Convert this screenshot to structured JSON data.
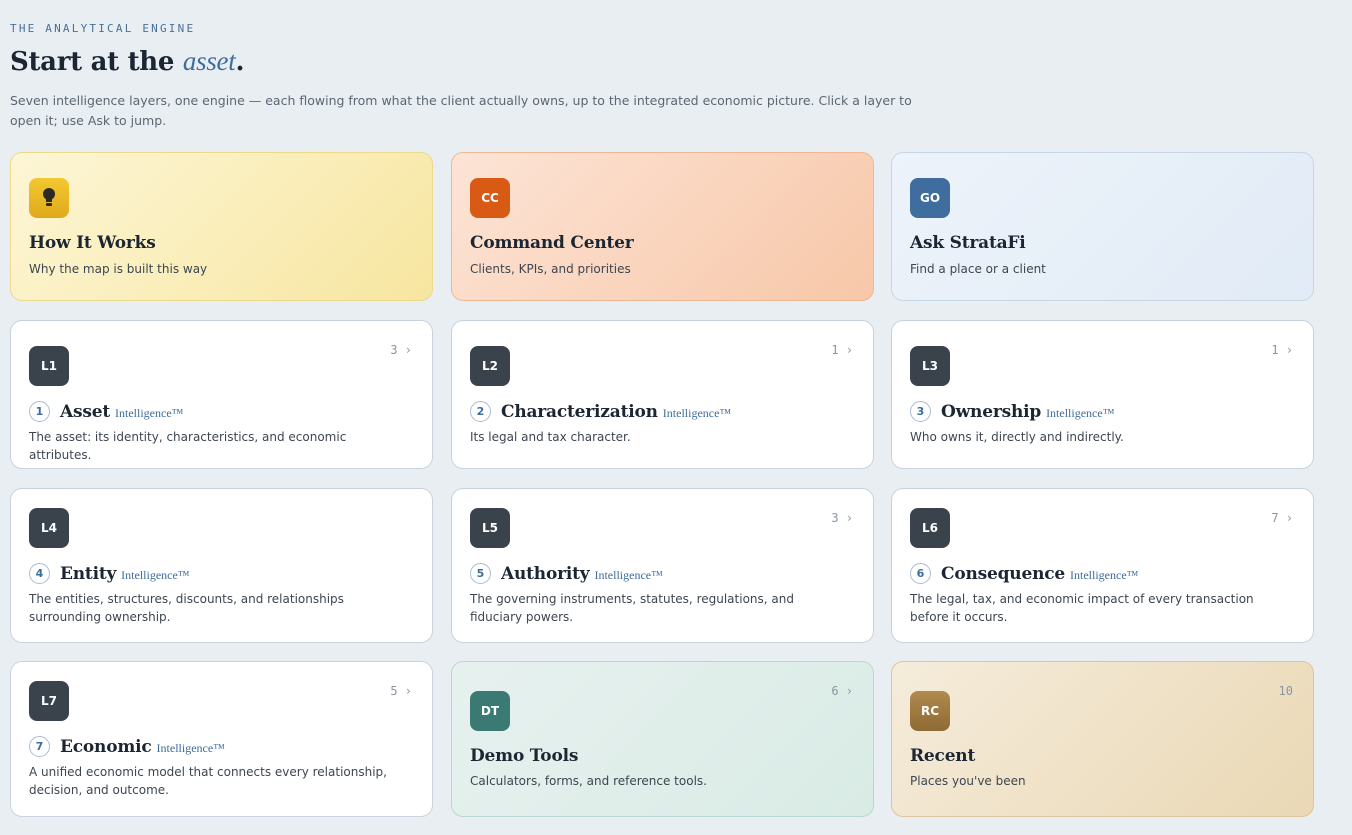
{
  "header": {
    "eyebrow": "THE ANALYTICAL ENGINE",
    "title_prefix": "Start at the ",
    "title_emphasis": "asset",
    "title_suffix": ".",
    "subtitle": "Seven intelligence layers, one engine — each flowing from what the client actually owns, up to the integrated economic picture. Click a layer to open it; use Ask to jump."
  },
  "top_cards": [
    {
      "badge": "",
      "icon": "lightbulb-icon",
      "title": "How It Works",
      "desc": "Why the map is built this way"
    },
    {
      "badge": "CC",
      "title": "Command Center",
      "desc": "Clients, KPIs, and priorities"
    },
    {
      "badge": "GO",
      "title": "Ask StrataFi",
      "desc": "Find a place or a client"
    }
  ],
  "layer_suffix": "Intelligence™",
  "layers": [
    {
      "badge": "L1",
      "num": "1",
      "name": "Asset",
      "desc": "The asset: its identity, characteristics, and economic attributes.",
      "count": "3 ›"
    },
    {
      "badge": "L2",
      "num": "2",
      "name": "Characterization",
      "desc": "Its legal and tax character.",
      "count": "1 ›"
    },
    {
      "badge": "L3",
      "num": "3",
      "name": "Ownership",
      "desc": "Who owns it, directly and indirectly.",
      "count": "1 ›"
    },
    {
      "badge": "L4",
      "num": "4",
      "name": "Entity",
      "desc": "The entities, structures, discounts, and relationships surrounding ownership.",
      "count": ""
    },
    {
      "badge": "L5",
      "num": "5",
      "name": "Authority",
      "desc": "The governing instruments, statutes, regulations, and fiduciary powers.",
      "count": "3 ›"
    },
    {
      "badge": "L6",
      "num": "6",
      "name": "Consequence",
      "desc": "The legal, tax, and economic impact of every transaction before it occurs.",
      "count": "7 ›"
    },
    {
      "badge": "L7",
      "num": "7",
      "name": "Economic",
      "desc": "A unified economic model that connects every relationship, decision, and outcome.",
      "count": "5 ›"
    }
  ],
  "bottom_cards": [
    {
      "badge": "DT",
      "title": "Demo Tools",
      "desc": "Calculators, forms, and reference tools.",
      "count": "6 ›"
    },
    {
      "badge": "RC",
      "title": "Recent",
      "desc": "Places you've been",
      "count": "10"
    }
  ]
}
